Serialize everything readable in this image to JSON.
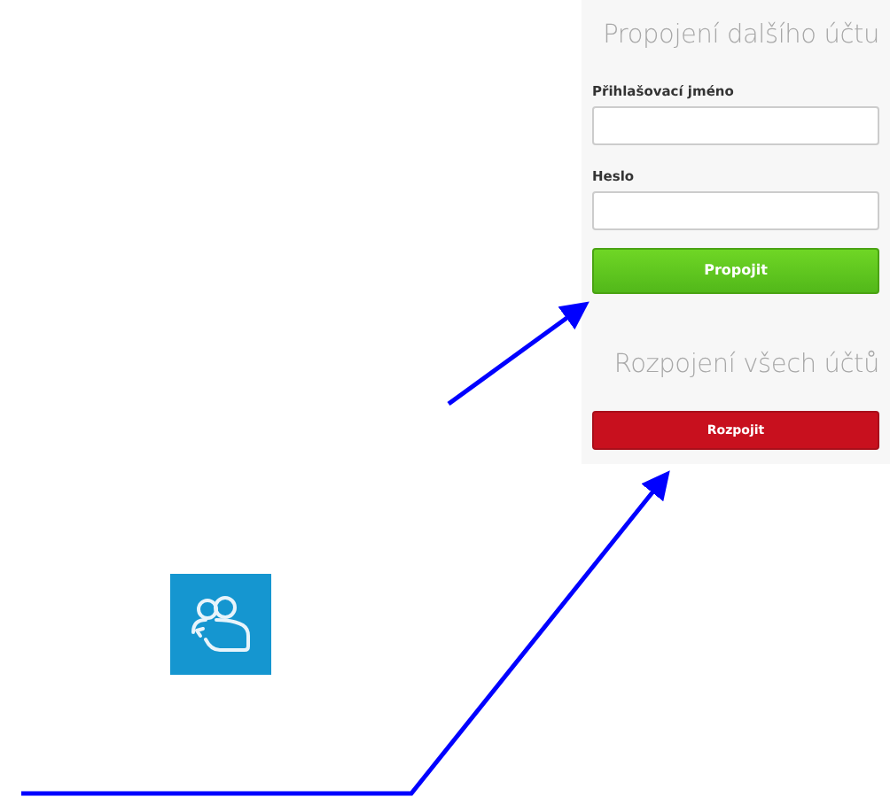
{
  "link_section": {
    "title": "Propojení dalšího účtu",
    "fields": [
      {
        "label": "Přihlašovací jméno"
      },
      {
        "label": "Heslo"
      }
    ],
    "button": "Propojit"
  },
  "unlink_section": {
    "title": "Rozpojení všech účtů",
    "button": "Rozpojit"
  }
}
